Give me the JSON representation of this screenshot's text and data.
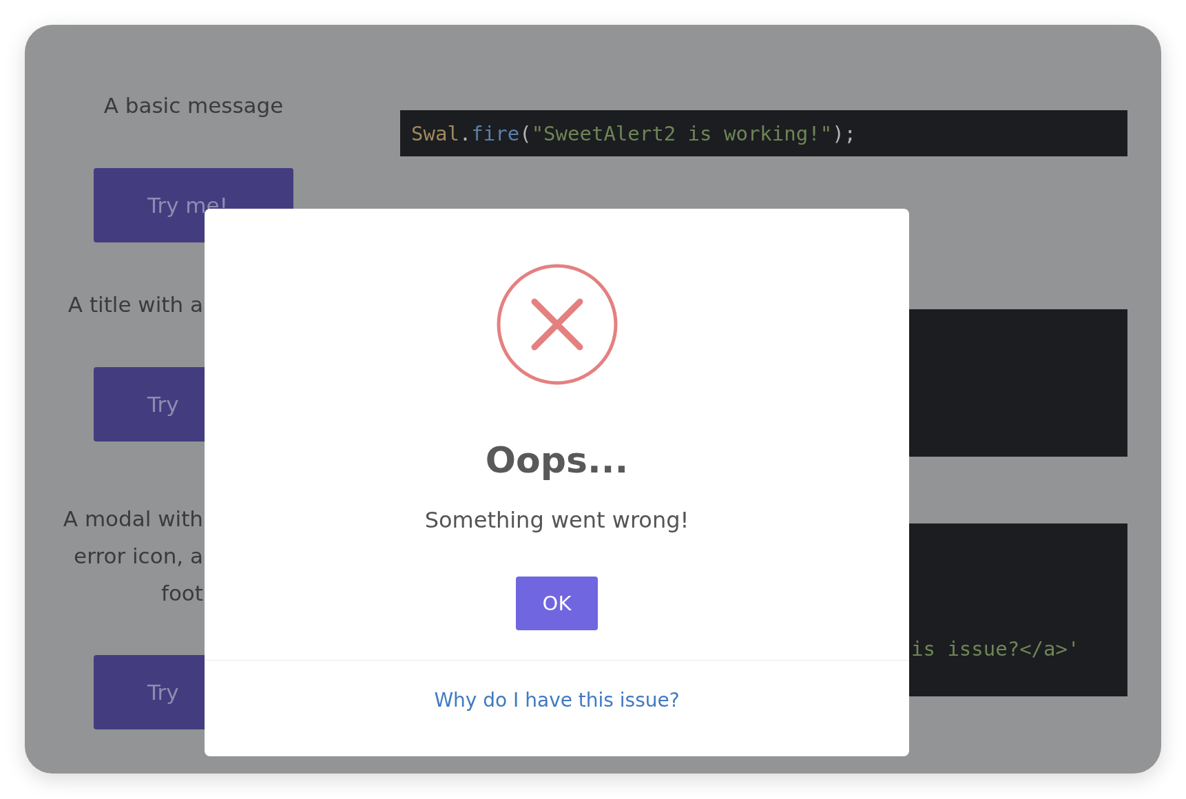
{
  "examples": [
    {
      "kind": "basic",
      "description_lines": [
        "A basic message"
      ],
      "button": "Try me!",
      "code": [
        {
          "kind": "object",
          "text": "Swal"
        },
        {
          "kind": "punct",
          "text": "."
        },
        {
          "kind": "method",
          "text": "fire"
        },
        {
          "kind": "punct",
          "text": "("
        },
        {
          "kind": "string",
          "text": "\"SweetAlert2 is working!\""
        },
        {
          "kind": "punct",
          "text": ");"
        }
      ]
    },
    {
      "kind": "title",
      "description_lines": [
        "A title with a"
      ],
      "button": "Try"
    },
    {
      "kind": "footer",
      "description_lines": [
        "A modal with",
        "error icon, a",
        "foot"
      ],
      "button": "Try",
      "code": [
        {
          "kind": "string",
          "text": "is issue?</a>'"
        }
      ]
    }
  ],
  "modal": {
    "kind": "error",
    "title": "Oops...",
    "text": "Something went wrong!",
    "confirm_button": "OK",
    "footer_link": "Why do I have this issue?"
  }
}
